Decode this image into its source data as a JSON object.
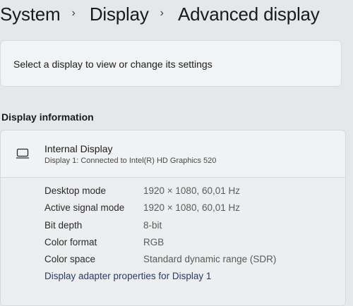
{
  "breadcrumb": {
    "items": [
      "System",
      "Display",
      "Advanced display"
    ],
    "separator": "›"
  },
  "select_card": {
    "text": "Select a display to view or change its settings"
  },
  "display_information": {
    "heading": "Display information",
    "display_name": "Internal Display",
    "display_subtitle": "Display 1: Connected to Intel(R) HD Graphics 520",
    "icon": "monitor-icon",
    "rows": [
      {
        "label": "Desktop mode",
        "value": "1920 × 1080, 60,01 Hz"
      },
      {
        "label": "Active signal mode",
        "value": "1920 × 1080, 60,01 Hz"
      },
      {
        "label": "Bit depth",
        "value": "8-bit"
      },
      {
        "label": "Color format",
        "value": "RGB"
      },
      {
        "label": "Color space",
        "value": "Standard dynamic range (SDR)"
      }
    ],
    "adapter_link": "Display adapter properties for Display 1"
  }
}
